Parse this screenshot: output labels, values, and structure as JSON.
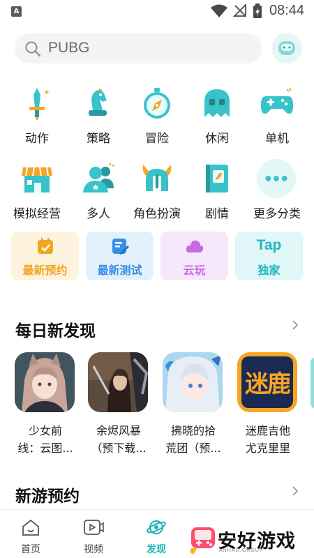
{
  "status_bar": {
    "time": "08:44",
    "notification_letter": "A"
  },
  "search": {
    "value": "PUBG"
  },
  "categories_row1": [
    {
      "label": "动作",
      "icon": "sword-icon"
    },
    {
      "label": "策略",
      "icon": "chess-knight-icon"
    },
    {
      "label": "冒险",
      "icon": "compass-icon"
    },
    {
      "label": "休闲",
      "icon": "ghost-icon"
    },
    {
      "label": "单机",
      "icon": "gamepad-icon"
    }
  ],
  "categories_row2": [
    {
      "label": "模拟经营",
      "icon": "shop-icon"
    },
    {
      "label": "多人",
      "icon": "multiplayer-icon"
    },
    {
      "label": "角色扮演",
      "icon": "viking-helmet-icon"
    },
    {
      "label": "剧情",
      "icon": "book-icon"
    },
    {
      "label": "更多分类",
      "icon": "more-icon"
    }
  ],
  "quick_cards": [
    {
      "label": "最新预约",
      "icon": "calendar-check-icon",
      "color": "#f2a623",
      "bg": "#fdf3de"
    },
    {
      "label": "最新测试",
      "icon": "edit-icon",
      "color": "#3a8ee6",
      "bg": "#e3f1fb"
    },
    {
      "label": "云玩",
      "icon": "cloud-icon",
      "color": "#c36be0",
      "bg": "#f5e8fb"
    },
    {
      "label": "独家",
      "icon_text": "Tap",
      "color": "#1fb6bf",
      "bg": "#e1f6f7"
    }
  ],
  "daily": {
    "title": "每日新发现",
    "games": [
      {
        "name_line1": "少女前",
        "name_line2": "线：云图..."
      },
      {
        "name_line1": "余烬风暴",
        "name_line2": "（预下载..."
      },
      {
        "name_line1": "拂晓的拾",
        "name_line2": "荒团（预..."
      },
      {
        "name_line1": "迷鹿吉他",
        "name_line2": "尤克里里"
      }
    ],
    "game4_logo": "迷鹿"
  },
  "new_games": {
    "title": "新游预约"
  },
  "bottom_nav": [
    {
      "label": "首页",
      "icon": "home-icon"
    },
    {
      "label": "视频",
      "icon": "video-icon"
    },
    {
      "label": "发现",
      "icon": "planet-icon",
      "active": true
    }
  ],
  "watermark": {
    "text": "安好游戏",
    "sub": "ANHAO.GROUP"
  },
  "colors": {
    "accent": "#1bb3b8",
    "teal_icon": "#37c3c9",
    "orange_icon": "#f6a623"
  }
}
